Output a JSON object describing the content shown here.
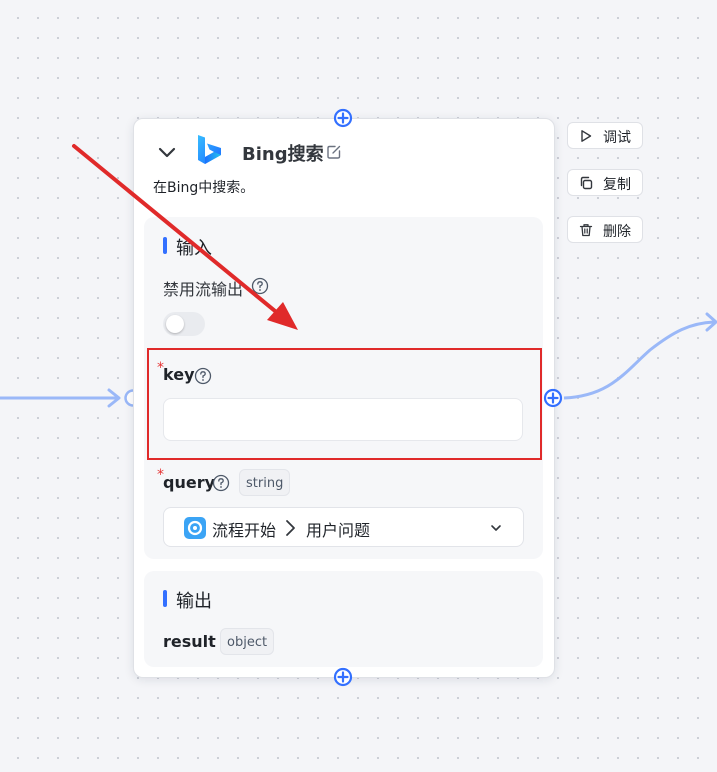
{
  "node": {
    "title": "Bing搜索",
    "description": "在Bing中搜索。",
    "icons": {
      "collapse": "chevron-down-icon",
      "logo": "bing-logo",
      "edit": "edit-icon"
    }
  },
  "input_section": {
    "title": "输入",
    "disable_stream": {
      "label": "禁用流输出",
      "enabled": false
    },
    "key": {
      "label": "key",
      "required": "*",
      "value": "",
      "placeholder": ""
    },
    "query": {
      "label": "query",
      "required": "*",
      "type_tag": "string",
      "source_node": "流程开始",
      "source_field": "用户问题"
    }
  },
  "output_section": {
    "title": "输出",
    "result": {
      "label": "result",
      "type_tag": "object"
    }
  },
  "side_actions": [
    {
      "label": "调试",
      "icon": "play-icon"
    },
    {
      "label": "复制",
      "icon": "copy-icon"
    },
    {
      "label": "删除",
      "icon": "trash-icon"
    }
  ],
  "colors": {
    "accent": "#3370ff",
    "connector": "#9ab8f8",
    "annotation": "#e02a2a",
    "required": "#e63232"
  }
}
